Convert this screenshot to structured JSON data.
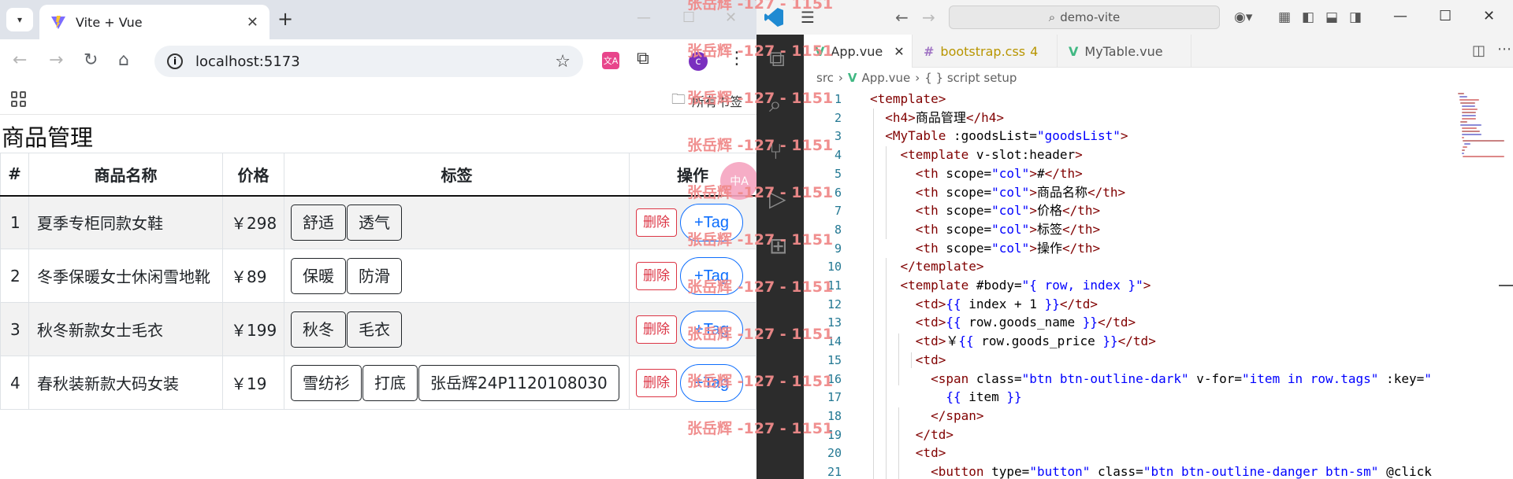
{
  "browser": {
    "tab_title": "Vite + Vue",
    "url": "localhost:5173",
    "avatar_letter": "c",
    "translate_ext": "文A",
    "bookmarks_label": "所有书签",
    "page": {
      "heading": "商品管理",
      "columns": [
        "#",
        "商品名称",
        "价格",
        "标签",
        "操作"
      ],
      "rows": [
        {
          "index": "1",
          "name": "夏季专柜同款女鞋",
          "price": "￥298",
          "tags": [
            "舒适",
            "透气"
          ]
        },
        {
          "index": "2",
          "name": "冬季保暖女士休闲雪地靴",
          "price": "￥89",
          "tags": [
            "保暖",
            "防滑"
          ]
        },
        {
          "index": "3",
          "name": "秋冬新款女士毛衣",
          "price": "￥199",
          "tags": [
            "秋冬",
            "毛衣"
          ]
        },
        {
          "index": "4",
          "name": "春秋装新款大码女装",
          "price": "￥19",
          "tags": [
            "雪纺衫",
            "打底",
            "张岳辉24P1120108030"
          ]
        }
      ],
      "delete_label": "删除",
      "add_tag_label": "+Tag",
      "translate_badge": "中A"
    }
  },
  "vscode": {
    "search_text": "demo-vite",
    "tabs": [
      {
        "label": "App.vue",
        "type": "vue",
        "active": true
      },
      {
        "label": "bootstrap.css",
        "type": "css",
        "badge": "4"
      },
      {
        "label": "MyTable.vue",
        "type": "vue"
      }
    ],
    "breadcrumb": [
      "src",
      "App.vue",
      "{ } script setup"
    ],
    "line_numbers": [
      "1",
      "2",
      "3",
      "4",
      "5",
      "6",
      "7",
      "8",
      "9",
      "10",
      "11",
      "12",
      "13",
      "14",
      "15",
      "16",
      "17",
      "18",
      "19",
      "20",
      "21"
    ],
    "code_lines": [
      "<template>",
      "  <h4>商品管理</h4>",
      "  <MyTable :goodsList=\"goodsList\">",
      "    <template v-slot:header>",
      "      <th scope=\"col\">#</th>",
      "      <th scope=\"col\">商品名称</th>",
      "      <th scope=\"col\">价格</th>",
      "      <th scope=\"col\">标签</th>",
      "      <th scope=\"col\">操作</th>",
      "    </template>",
      "    <template #body=\"{ row, index }\">",
      "      <td>{{ index + 1 }}</td>",
      "      <td>{{ row.goods_name }}</td>",
      "      <td>￥{{ row.goods_price }}</td>",
      "      <td>",
      "        <span class=\"btn btn-outline-dark\" v-for=\"item in row.tags\" :key=\"",
      "          {{ item }}",
      "        </span>",
      "      </td>",
      "      <td>",
      "        <button type=\"button\" class=\"btn btn-outline-danger btn-sm\" @click"
    ]
  },
  "watermark": "张岳辉 -127 - 1151",
  "colors": {
    "chrome_tabstrip": "#dfe3ea",
    "vscode_activity": "#2c2c2c",
    "danger": "#dc3545",
    "primary": "#0d6efd",
    "vue_green": "#41b883",
    "watermark": "#f08a8a"
  }
}
